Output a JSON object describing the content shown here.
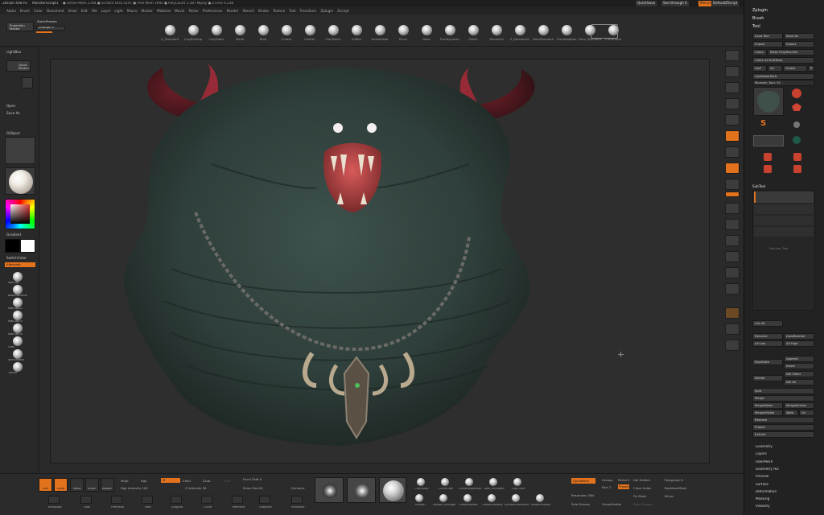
{
  "titlebar": {
    "app": "ZBrush 4R8 P2",
    "doc": "MonsterSculpt1",
    "stats": "● Active Mem 2784 ● Scratch Disk 5247 ● Free Mem 2992 ● PolyCount 2.287 Mpoly ● ZTime 0.238",
    "quicksave": "QuickSave",
    "seethrough": "See-through 0",
    "menus": "Menus",
    "script": "DefaultZScript"
  },
  "menubar": [
    "Alpha",
    "Brush",
    "Color",
    "Document",
    "Draw",
    "Edit",
    "File",
    "Layer",
    "Light",
    "Macro",
    "Marker",
    "Material",
    "Movie",
    "Picker",
    "Preferences",
    "Render",
    "Stencil",
    "Stroke",
    "Texture",
    "Tool",
    "Transform",
    "Zplugin",
    "Zscript"
  ],
  "projection": {
    "label": "Projection Master",
    "lightbox": "LightBox",
    "quick_sketch": "Quick Sketch",
    "strength_label": "Strength 0"
  },
  "brushes": [
    {
      "name": "Z_Standard"
    },
    {
      "name": "ClayBuildup"
    },
    {
      "name": "ClayTubes"
    },
    {
      "name": "Move"
    },
    {
      "name": "Blob"
    },
    {
      "name": "Crease"
    },
    {
      "name": "hPolish"
    },
    {
      "name": "ClayPolish"
    },
    {
      "name": "Inflate"
    },
    {
      "name": "SnakeHook"
    },
    {
      "name": "Pinch"
    },
    {
      "name": "Rake"
    },
    {
      "name": "TrimDynamic"
    },
    {
      "name": "Polish"
    },
    {
      "name": "Standard"
    },
    {
      "name": "Z_Standard2"
    },
    {
      "name": "DamStandard"
    },
    {
      "name": "TrimAdaptive"
    },
    {
      "name": "Dam_Standard"
    },
    {
      "name": "CurveTube"
    }
  ],
  "left_panel": {
    "open": "Open",
    "save_as": "Save As",
    "gradient": "Gradient",
    "switch_color": "SwitchColor",
    "alternate": "Alternate",
    "materials": [
      "MatCap",
      "BasicMaterial",
      "MatCap02",
      "MatCap03",
      "MatCap04",
      "Gray",
      "SkinShade4",
      "Tjbflat"
    ],
    "lightbox_label": "LightBox",
    "pm_label": "Projection Master"
  },
  "tray": {
    "zplugin": "Zplugin",
    "brush": "Brush",
    "tool": "Tool",
    "load_tool": "Load Tool",
    "save_as": "Save As",
    "import": "Import",
    "export": "Export",
    "clone": "Clone",
    "make_polymesh": "Make PolyMesh3D",
    "clone_all_subtools": "Clone All SubTools",
    "goz": "GoZ",
    "all": "All",
    "visible": "Visible",
    "r": "R",
    "lightbox_tools": "Lightbox▸Tools",
    "current_tool": "Monster_Tool: 50",
    "tool_names": [
      "Monster_Tool",
      "Cylinder3D",
      "PolyMesh3D",
      "SimpleBrush",
      "Sphere3D",
      "Plane3D",
      "Cube3D",
      "PM3D_Cyl3D",
      "PM3D_Cyl3D_1"
    ],
    "subtool_label": "SubTool",
    "subtools": [
      "Monster_Tool",
      "Chain",
      "Horns",
      "Amulet"
    ],
    "list_all": "List All",
    "rename": "Rename",
    "autoreorder": "AutoReorder",
    "all_low": "All Low",
    "all_high": "All High",
    "duplicate": "Duplicate",
    "append": "Append",
    "insert": "Insert",
    "delete": "Delete",
    "del_other": "Del Other",
    "del_all": "Del All",
    "split": "Split",
    "merge": "Merge",
    "mergedown": "MergeDown",
    "mergesimilar": "MergeSimilar",
    "mergevisible": "MergeVisible",
    "weld": "Weld",
    "uv": "Uv",
    "remesh": "Remesh",
    "project": "Project",
    "extract": "Extract",
    "sections": [
      "Geometry",
      "Layers",
      "FiberMesh",
      "Geometry HD",
      "Preview",
      "Surface",
      "Deformation",
      "Masking",
      "Visibility"
    ]
  },
  "bottom": {
    "edit": "Edit",
    "draw": "Draw",
    "move": "Move",
    "scale": "Scale",
    "rotate": "Rotate",
    "mrgb": "Mrgb",
    "rgb": "Rgb",
    "m": "M",
    "zadd": "Zadd",
    "zsub": "Zsub",
    "zcut": "Zcut",
    "rgb_intensity": "Rgb Intensity 100",
    "z_intensity": "Z Intensity 36",
    "focal_shift": "Focal Shift 0",
    "draw_size": "Draw Size 82",
    "dynamic": "Dynamic",
    "tool_labels": [
      "Transpose",
      "Dots",
      "FreeHand",
      "Rect",
      "DragDot",
      "Curve",
      "FreeHand",
      "DragRect",
      "TransPose"
    ],
    "alpha_labels": [
      "Alpha",
      "Stroke",
      "Material"
    ],
    "smooth_labels": [
      "Smooth",
      "Smooth Stronger",
      "SmoothPeaks",
      "SmoothValleys",
      "SmoothDirectional",
      "SmoothSubdiv",
      "ClayLine",
      "ClipCurve"
    ],
    "smooth_names": [
      "ClayTubes",
      "CurveTube",
      "CurveSnakeHook",
      "Dam_Standard",
      "ClipCurve"
    ],
    "dynamesh": "DynaMesh",
    "groups": "Groups",
    "polish": "Polish 0",
    "blur": "Blur 2",
    "project": "Project",
    "resolution": "Resolution 384",
    "solo_groups": "Solo Groups",
    "group_visible": "GroupVisible",
    "del_hidden": "Del Hidden",
    "close_holes": "Close Holes",
    "fix_mesh": "Fix Mesh",
    "auto_groups": "Auto Groups",
    "polygroup_it": "Polygroup It",
    "mirror": "Mirror",
    "backface": "BackfaceMask",
    "polyframe": "PolyF"
  },
  "colors": {
    "accent": "#e3721d",
    "panel": "#2a2a2a",
    "viewport": "#2e2e2e",
    "main_color": "#ffffff",
    "secondary_color": "#000000"
  }
}
